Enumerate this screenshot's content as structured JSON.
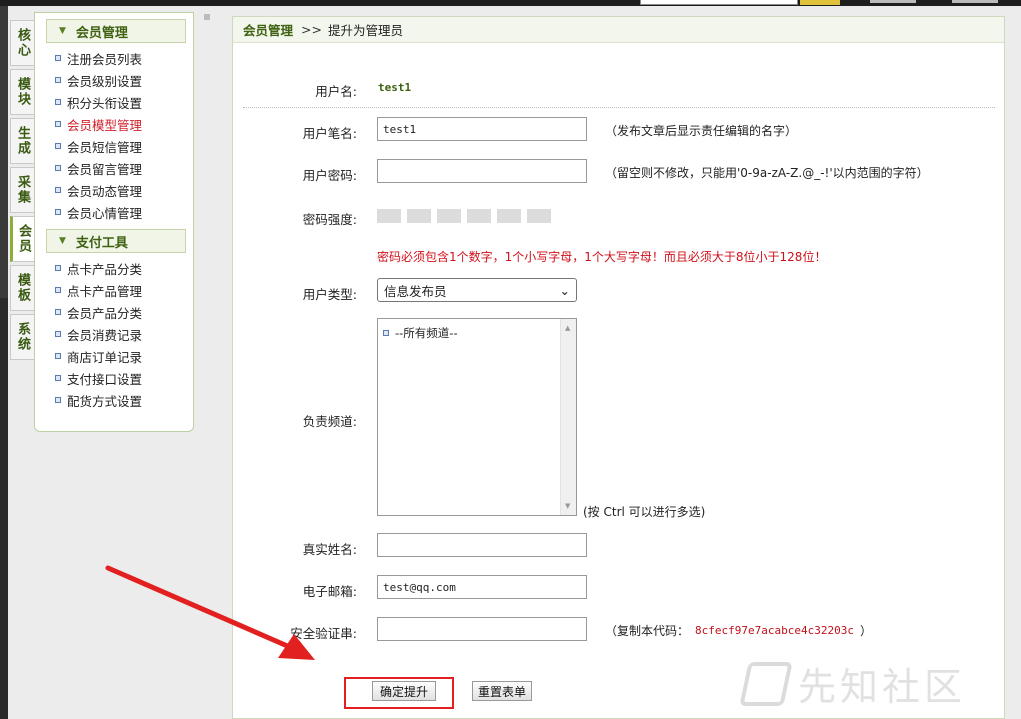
{
  "side_tabs": [
    "核心",
    "模块",
    "生成",
    "采集",
    "会员",
    "模板",
    "系统"
  ],
  "active_tab": 4,
  "menu": {
    "groups": [
      {
        "title": "会员管理",
        "items": [
          "注册会员列表",
          "会员级别设置",
          "积分头衔设置",
          "会员模型管理",
          "会员短信管理",
          "会员留言管理",
          "会员动态管理",
          "会员心情管理"
        ]
      },
      {
        "title": "支付工具",
        "items": [
          "点卡产品分类",
          "点卡产品管理",
          "会员产品分类",
          "会员消费记录",
          "商店订单记录",
          "支付接口设置",
          "配货方式设置"
        ]
      }
    ],
    "highlighted_item": "会员模型管理"
  },
  "breadcrumb": {
    "section": "会员管理",
    "separator": ">>",
    "page": "提升为管理员"
  },
  "form": {
    "username_label": "用户名:",
    "username_value": "test1",
    "penname_label": "用户笔名:",
    "penname_value": "test1",
    "penname_hint": "（发布文章后显示责任编辑的名字）",
    "password_label": "用户密码:",
    "password_value": "",
    "password_hint": "（留空则不修改，只能用'0-9a-zA-Z.@_-!'以内范围的字符）",
    "strength_label": "密码强度:",
    "strength_warning": "密码必须包含1个数字，1个小写字母，1个大写字母！而且必须大于8位小于128位！",
    "usertype_label": "用户类型:",
    "usertype_value": "信息发布员",
    "channel_label": "负责频道:",
    "channel_option": "--所有频道--",
    "channel_hint": "(按 Ctrl 可以进行多选)",
    "realname_label": "真实姓名:",
    "realname_value": "",
    "email_label": "电子邮箱:",
    "email_value": "test@qq.com",
    "safecode_label": "安全验证串:",
    "safecode_value": "",
    "safecode_hint_prefix": "（复制本代码：",
    "safecode_code": "8cfecf97e7acabce4c32203c",
    "safecode_hint_suffix": "）",
    "submit_label": "确定提升",
    "reset_label": "重置表单"
  },
  "watermark": {
    "text": "先知社区"
  },
  "colors": {
    "accent_green": "#3f6112",
    "warning_red": "#d0101a",
    "annotation_red": "#e32020"
  }
}
